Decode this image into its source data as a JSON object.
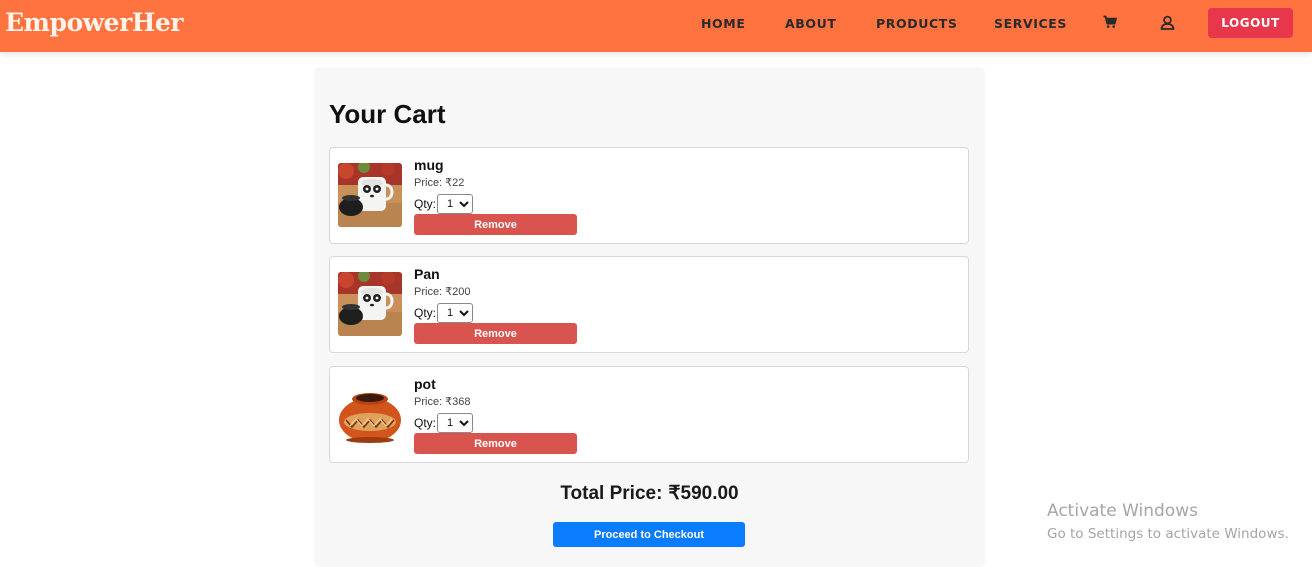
{
  "header": {
    "logo": "EmpowerHer",
    "nav": [
      {
        "label": "HOME"
      },
      {
        "label": "ABOUT"
      },
      {
        "label": "PRODUCTS"
      },
      {
        "label": "SERVICES"
      }
    ],
    "cart_icon": "shopping-cart-icon",
    "profile_icon": "user-profile-icon",
    "logout_label": "LOGOUT",
    "colors": {
      "bar": "#ff7340",
      "logout": "#e8374a"
    }
  },
  "cart": {
    "title": "Your Cart",
    "price_label": "Price:",
    "qty_label": "Qty:",
    "remove_label": "Remove",
    "items": [
      {
        "name": "mug",
        "price": "₹22",
        "qty": "1",
        "image": "panda-mug-image"
      },
      {
        "name": "Pan",
        "price": "₹200",
        "qty": "1",
        "image": "panda-mug-image"
      },
      {
        "name": "pot",
        "price": "₹368",
        "qty": "1",
        "image": "clay-pot-image"
      }
    ],
    "total_label": "Total Price:",
    "total_value": "₹590.00",
    "checkout_label": "Proceed to Checkout",
    "colors": {
      "remove": "#d9534f",
      "checkout": "#0a7cff"
    }
  },
  "watermark": {
    "title": "Activate Windows",
    "subtitle": "Go to Settings to activate Windows."
  }
}
